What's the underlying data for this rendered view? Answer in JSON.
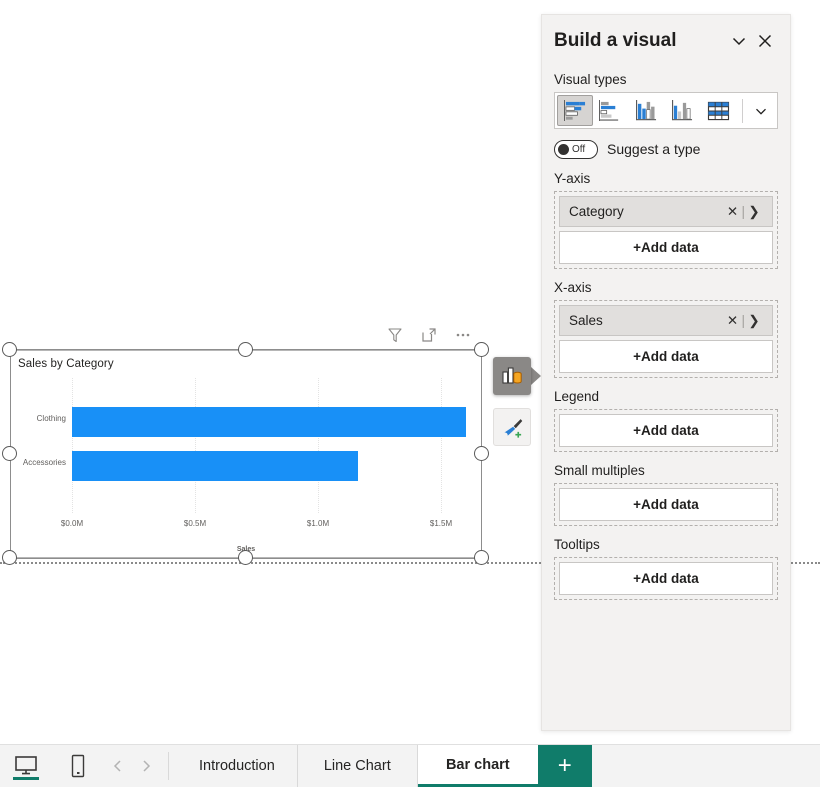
{
  "panel": {
    "title": "Build a visual",
    "collapse_icon": "chevron-down-icon",
    "close_icon": "close-icon",
    "visual_types_label": "Visual types",
    "visual_types": [
      {
        "name": "stacked-bar-chart",
        "selected": true
      },
      {
        "name": "clustered-bar-chart",
        "selected": false
      },
      {
        "name": "stacked-column-chart",
        "selected": false
      },
      {
        "name": "clustered-column-chart",
        "selected": false
      },
      {
        "name": "table-visual",
        "selected": false
      }
    ],
    "more_types_icon": "chevron-down-icon",
    "suggest": {
      "state": "Off",
      "label": "Suggest a type"
    },
    "wells": [
      {
        "label": "Y-axis",
        "field": "Category",
        "remove_icon": "close-icon",
        "expand_icon": "chevron-right-icon",
        "add_label": "+Add data"
      },
      {
        "label": "X-axis",
        "field": "Sales",
        "remove_icon": "close-icon",
        "expand_icon": "chevron-right-icon",
        "add_label": "+Add data"
      },
      {
        "label": "Legend",
        "field": null,
        "add_label": "+Add data"
      },
      {
        "label": "Small multiples",
        "field": null,
        "add_label": "+Add data"
      },
      {
        "label": "Tooltips",
        "field": null,
        "add_label": "+Add data"
      }
    ]
  },
  "visual": {
    "header_icons": [
      {
        "name": "filter-icon"
      },
      {
        "name": "focus-mode-icon"
      },
      {
        "name": "more-options-icon"
      }
    ],
    "side_buttons": [
      {
        "name": "build-visual-button",
        "icon": "build-visual-icon",
        "active": true
      },
      {
        "name": "format-visual-button",
        "icon": "paintbrush-plus-icon",
        "active": false
      }
    ]
  },
  "chart_data": {
    "type": "bar",
    "title": "Sales by Category",
    "orientation": "horizontal",
    "categories": [
      "Clothing",
      "Accessories"
    ],
    "values": [
      1.6,
      1.16
    ],
    "value_unit": "M",
    "xlabel": "Sales",
    "ylabel": "",
    "xlim": [
      0,
      1.75
    ],
    "xticks": [
      0,
      0.5,
      1.0,
      1.5
    ],
    "xticklabels": [
      "$0.0M",
      "$0.5M",
      "$1.0M",
      "$1.5M"
    ],
    "grid": true,
    "legend": "none",
    "bar_color": "#1890f7"
  },
  "bottom_bar": {
    "views": [
      {
        "name": "desktop-view",
        "icon": "monitor-icon",
        "active": true
      },
      {
        "name": "mobile-view",
        "icon": "phone-icon",
        "active": false
      }
    ],
    "nav": [
      {
        "name": "prev-page",
        "icon": "chevron-left-icon"
      },
      {
        "name": "next-page",
        "icon": "chevron-right-icon"
      }
    ],
    "tabs": [
      {
        "label": "Introduction",
        "active": false
      },
      {
        "label": "Line Chart",
        "active": false
      },
      {
        "label": "Bar chart",
        "active": true
      }
    ],
    "add_tab": {
      "name": "add-page-button",
      "label": "+"
    }
  }
}
